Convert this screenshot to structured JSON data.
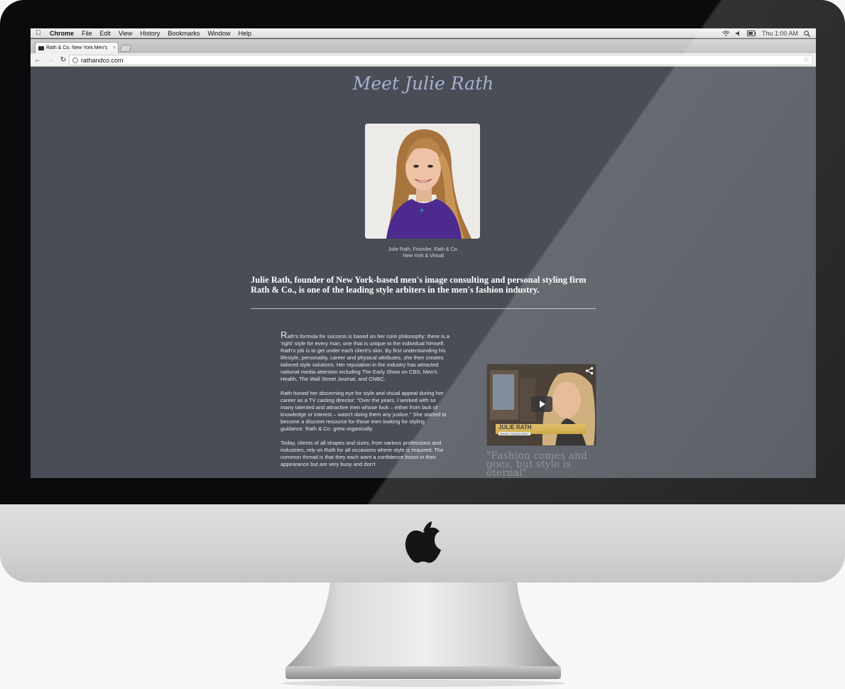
{
  "menubar": {
    "app": "Chrome",
    "items": [
      "File",
      "Edit",
      "View",
      "History",
      "Bookmarks",
      "Window",
      "Help"
    ],
    "clock": "Thu 1:00 AM"
  },
  "browser": {
    "tab_title": "Rath & Co. New York Men's",
    "tab_close": "×",
    "url": "rathandco.com"
  },
  "page": {
    "title": "Meet Julie Rath",
    "caption_line1": "Julie Rath, Founder, Rath & Co.",
    "caption_line2": "New York & Virtual",
    "lead": "Julie Rath, founder of New York-based men's image consulting and personal styling firm Rath & Co., is one of the leading style arbiters in the men's fashion industry.",
    "paragraph1_initial": "R",
    "paragraph1": "ath's formula for success is based on her core philosophy: there is a 'right' style for every man, one that is unique to the individual himself. Rath's job is to get under each client's skin. By first understanding his lifestyle, personality, career and physical attributes, she then creates tailored style solutions. Her reputation in the industry has attracted national media attention including The Early Show on CBS, Men's Health, The Wall Street Journal, and CNBC.",
    "paragraph2": "Rath honed her discerning eye for style and visual appeal during her career as a TV casting director: \"Over the years, I worked with so many talented and attractive men whose look – either from lack of knowledge or interest – wasn't doing them any justice.\" She started to become a discreet resource for those men looking for styling guidance. Rath & Co. grew organically.",
    "paragraph3": "Today, clients of all shapes and sizes, from various professions and industries, rely on Rath for all occasions where style is required. The common thread is that they each want a confidence boost in their appearance but are very busy and don't",
    "video_name": "JULIE RATH",
    "video_subtitle": "IMAGE CONSULTANT",
    "quote": "\"Fashion comes and goes, but style is eternal\""
  }
}
